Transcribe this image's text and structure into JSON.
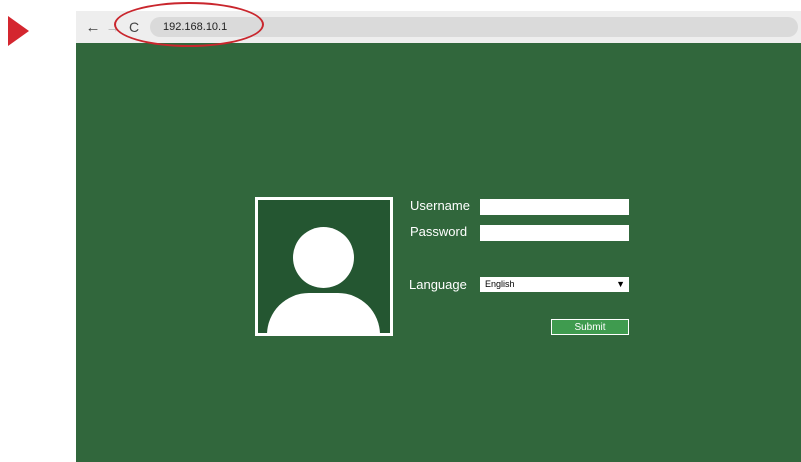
{
  "browser": {
    "address": "192.168.10.1",
    "back_icon": "←",
    "forward_icon": "→",
    "reload_icon": "C"
  },
  "login": {
    "username_label": "Username",
    "password_label": "Password",
    "language_label": "Language",
    "language_value": "English",
    "dropdown_icon": "▼",
    "submit_label": "Submit"
  },
  "colors": {
    "background": "#31673c",
    "avatar_bg": "#245631",
    "submit": "#3f9b4f",
    "highlight": "#c9262d",
    "marker": "#d4262f"
  }
}
